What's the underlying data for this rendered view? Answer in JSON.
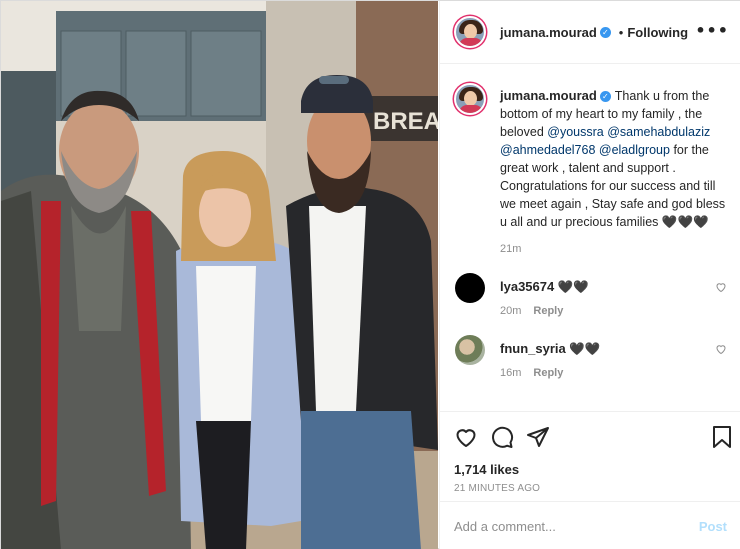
{
  "post": {
    "username": "jumana.mourad",
    "follow_status": "Following",
    "separator": "•"
  },
  "caption": {
    "username": "jumana.mourad",
    "text_1": "Thank u from the bottom of my heart to my family , the beloved ",
    "mention_1": "@youssra",
    "mention_2": "@samehabdulaziz",
    "mention_3": "@ahmedadel768",
    "mention_4": "@eladlgroup",
    "text_2": " for the great work , talent and support . Congratulations for our success and till we meet again , Stay safe and god bless u all and ur precious families 🖤🖤🖤",
    "time": "21m"
  },
  "comments": [
    {
      "username": "lya35674",
      "text": "🖤🖤",
      "time": "20m",
      "reply": "Reply"
    },
    {
      "username": "fnun_syria",
      "text": "🖤🖤",
      "time": "16m",
      "reply": "Reply"
    }
  ],
  "stats": {
    "likes": "1,714 likes",
    "posted": "21 MINUTES AGO"
  },
  "composer": {
    "placeholder": "Add a comment...",
    "post_label": "Post"
  },
  "colors": {
    "verified": "#3897f0",
    "mention": "#00376b",
    "post_disabled": "#b2dffc",
    "secondary_text": "#8e8e8e"
  },
  "icons": [
    "more-options-icon",
    "verified-badge-icon",
    "heart-icon",
    "comment-icon",
    "share-icon",
    "bookmark-icon"
  ]
}
